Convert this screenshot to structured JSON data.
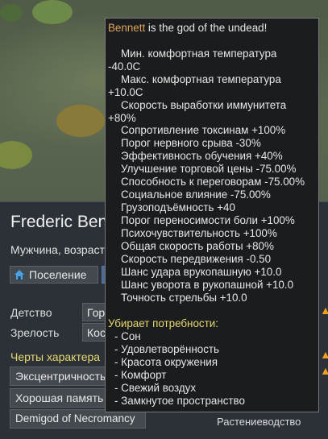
{
  "tooltip": {
    "god_name": "Bennett",
    "title_rest": " is the god of the undead!",
    "stats": [
      "Мин. комфортная температура",
      "-40.0C",
      "Макс. комфортная температура",
      "+10.0C",
      "Скорость выработки иммунитета",
      "+80%",
      "Сопротивление токсинам +100%",
      "Порог нервного срыва -30%",
      "Эффективность обучения +40%",
      "Улучшение торговой цены -75.00%",
      "Способность к переговорам -75.00%",
      "Социальное влияние -75.00%",
      "Грузоподъёмность +40",
      "Порог переносимости боли +100%",
      "Психочувствительность +100%",
      "Общая скорость работы +80%",
      "Скорость передвижения -0.50",
      "Шанс удара врукопашную +10.0",
      "Шанс уворота в рукопашной +10.0",
      "Точность стрельбы +10.0"
    ],
    "removes_header": "Убирает потребности:",
    "removed_needs": [
      "- Сон",
      "- Удовлетворённость",
      "- Красота окружения",
      "- Комфорт",
      "- Свежий воздух",
      "- Замкнутое пространство"
    ]
  },
  "character": {
    "name": "Frederic Ben",
    "description": "Мужчина, возраст",
    "settlement_label": "Поселение",
    "backstory": [
      {
        "label": "Детство",
        "value": "Гор"
      },
      {
        "label": "Зрелость",
        "value": "Кос"
      }
    ],
    "traits_header": "Черты характера",
    "traits": [
      "Эксцентричность",
      "Хорошая память",
      "Demigod of Necromancy"
    ],
    "skills": [
      "Растениеводство"
    ]
  },
  "colors": {
    "god_name": "#e0a45a",
    "header_yellow": "#e8d870",
    "tooltip_bg": "#1a1c1e",
    "panel_bg": "#2b3137",
    "settlement_icon": "#4aa0e0"
  },
  "icons": {
    "settlement": "home-icon",
    "passion": "flame-icon"
  }
}
